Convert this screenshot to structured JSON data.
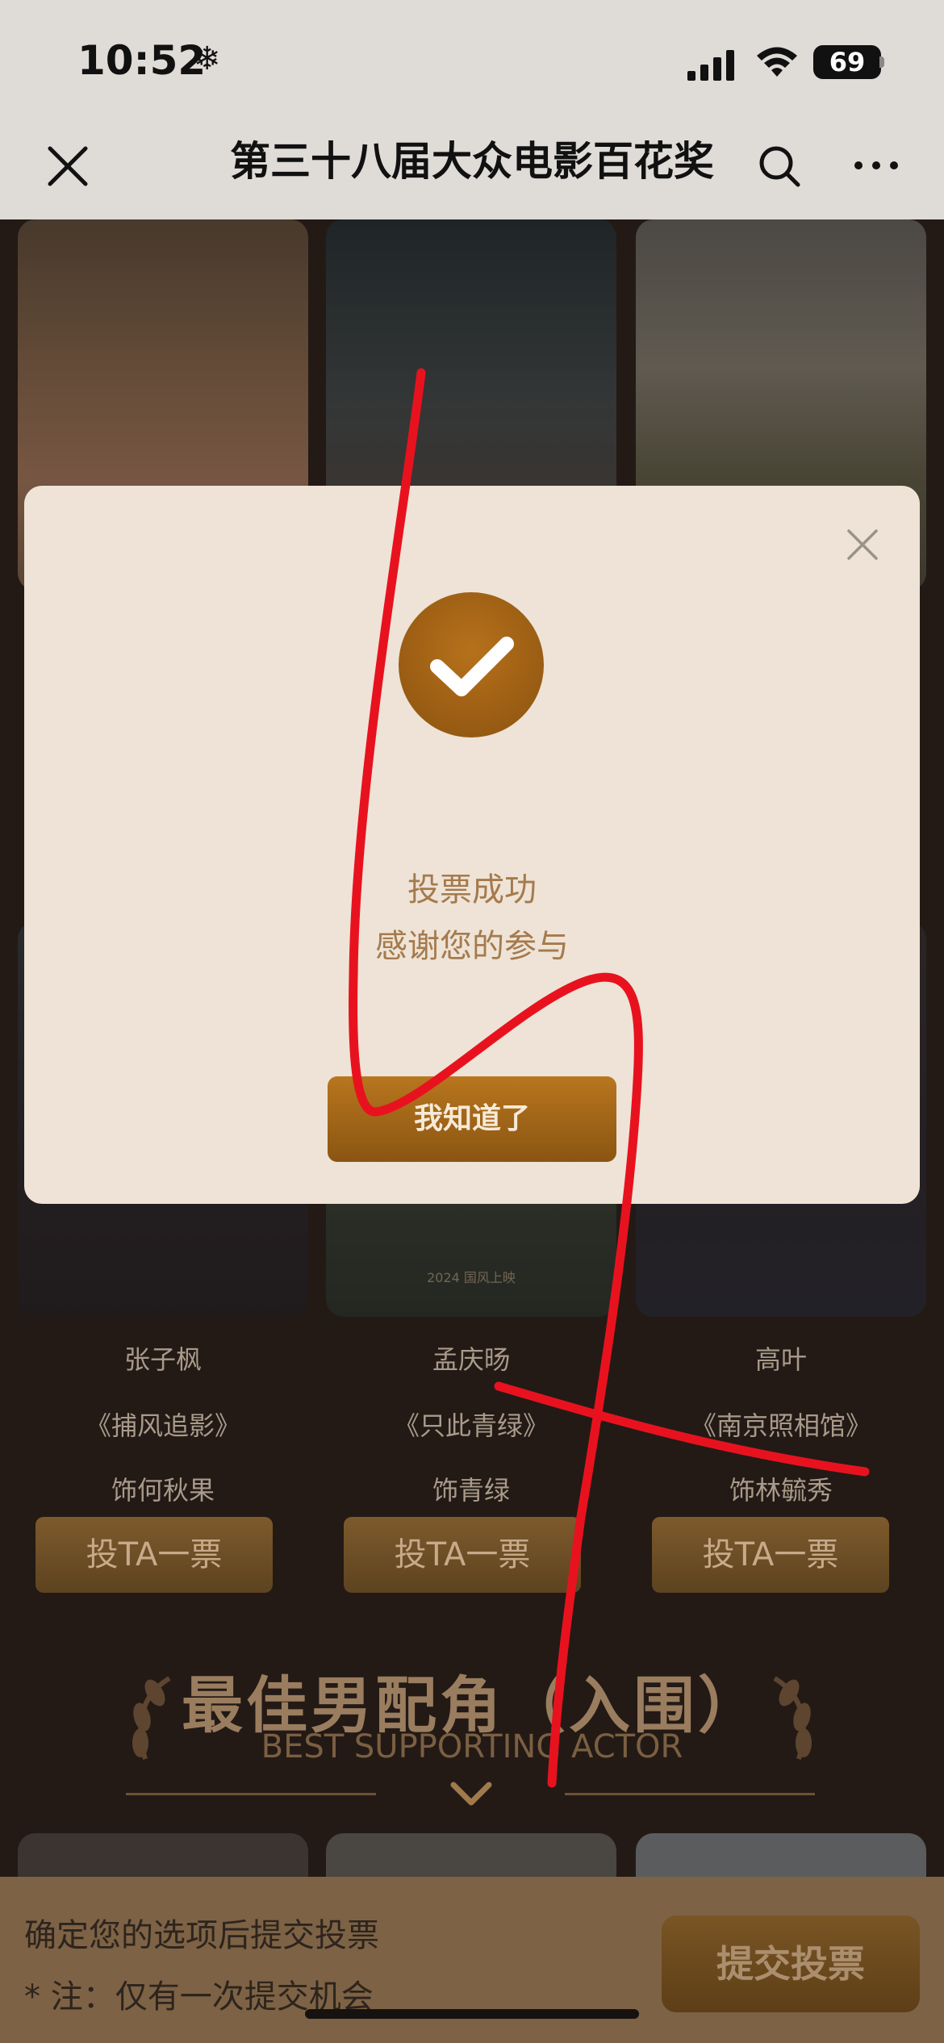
{
  "status_bar": {
    "time": "10:52",
    "time_icon": "❄",
    "battery": "69"
  },
  "header": {
    "title": "第三十八届大众电影百花奖"
  },
  "nominees": [
    {
      "name": "张子枫",
      "film": "《捕风追影》",
      "role": "饰何秋果",
      "vote_label": "投TA一票"
    },
    {
      "name": "孟庆旸",
      "film": "《只此青绿》",
      "role": "饰青绿",
      "vote_label": "投TA一票"
    },
    {
      "name": "高叶",
      "film": "《南京照相馆》",
      "role": "饰林毓秀",
      "vote_label": "投TA一票"
    }
  ],
  "poster_caption": "2024 国风上映",
  "section": {
    "title": "最佳男配角（入围）",
    "subtitle": "BEST SUPPORTING ACTOR"
  },
  "bottom_bar": {
    "hint": "确定您的选项后提交投票",
    "note": "* 注：仅有一次提交机会",
    "submit_label": "提交投票"
  },
  "modal": {
    "line1": "投票成功",
    "line2": "感谢您的参与",
    "button_label": "我知道了"
  },
  "colors": {
    "accent": "#a0660f",
    "scribble": "#e8121f",
    "modal_bg": "#eee3d6"
  }
}
